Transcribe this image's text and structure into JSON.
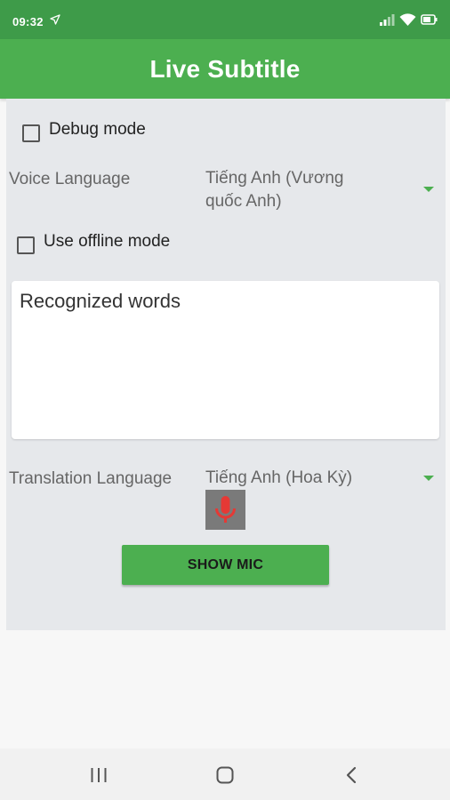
{
  "status_bar": {
    "time": "09:32",
    "icons": [
      "navigation-arrow-icon",
      "signal-icon",
      "wifi-icon",
      "battery-icon"
    ]
  },
  "app_bar": {
    "title": "Live Subtitle"
  },
  "settings": {
    "debug_mode_label": "Debug mode",
    "debug_mode_checked": false,
    "voice_language_label": "Voice Language",
    "voice_language_value": "Tiếng Anh (Vương quốc Anh)",
    "offline_mode_label": "Use offline mode",
    "offline_mode_checked": false,
    "translation_language_label": "Translation Language",
    "translation_language_value": "Tiếng Anh (Hoa Kỳ)"
  },
  "recognized": {
    "text": "Recognized words"
  },
  "actions": {
    "show_mic_label": "SHOW MIC"
  },
  "colors": {
    "primary": "#4caf50",
    "status_bar": "#3e9b49",
    "mic_icon": "#e53935"
  },
  "nav_bar": {
    "icons": [
      "recent-apps-icon",
      "home-icon",
      "back-icon"
    ]
  }
}
